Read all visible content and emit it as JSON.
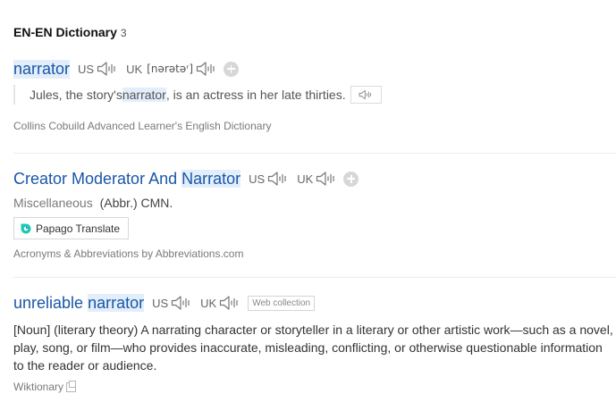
{
  "section": {
    "title": "EN-EN Dictionary",
    "count": "3"
  },
  "entries": [
    {
      "headword": "narrator",
      "us_label": "US",
      "uk_label": "UK",
      "uk_phonetic": "[nərətəʳ]",
      "example": {
        "before": "Jules, the story's ",
        "highlight": "narrator",
        "after": ", is an actress in her late thirties."
      },
      "source": "Collins Cobuild Advanced Learner's English Dictionary"
    },
    {
      "headword_parts": [
        "Creator Moderator And ",
        "Narrator"
      ],
      "us_label": "US",
      "uk_label": "UK",
      "category": "Miscellaneous",
      "meaning": "(Abbr.) CMN.",
      "papago_label": "Papago Translate",
      "source": "Acronyms & Abbreviations by Abbreviations.com"
    },
    {
      "headword_parts": [
        "unreliable ",
        "narrator"
      ],
      "us_label": "US",
      "uk_label": "UK",
      "tag": "Web collection",
      "definition": "[Noun] (literary theory) A narrating character or storyteller in a literary or other artistic work—such as a novel, play, song, or film—who provides inaccurate, misleading, conflicting, or otherwise questionable information to the reader or audience.",
      "source": "Wiktionary"
    }
  ],
  "icons": {
    "speaker": "speaker-icon",
    "add": "plus-circle-icon",
    "papago": "papago-logo-icon",
    "external": "external-link-icon"
  },
  "colors": {
    "headword": "#1a56a8",
    "highlight": "#e3eefb"
  }
}
